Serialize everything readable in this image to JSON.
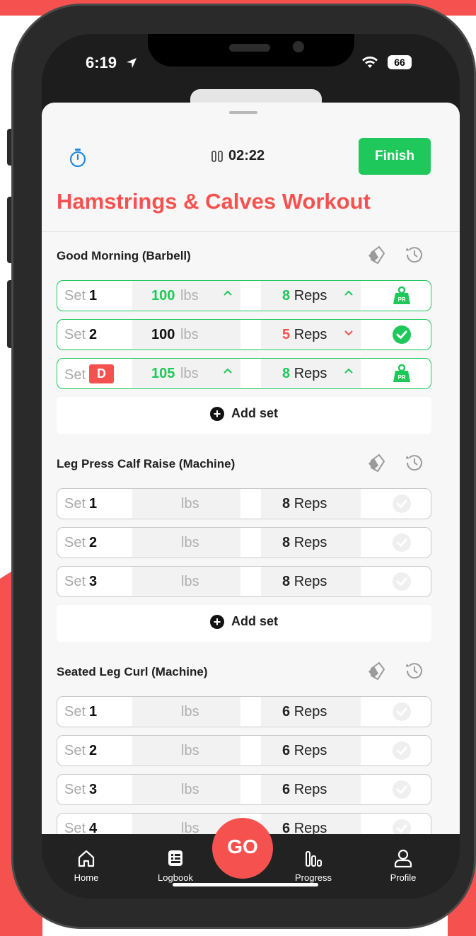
{
  "status_bar": {
    "time": "6:19",
    "battery": "66"
  },
  "header": {
    "clock": "02:22",
    "finish_label": "Finish",
    "title": "Hamstrings & Calves Workout"
  },
  "exercises": [
    {
      "name": "Good Morning (Barbell)",
      "sets": [
        {
          "label": "Set",
          "number": "1",
          "weight": "100",
          "unit": "lbs",
          "reps": "8",
          "reps_unit": "Reps",
          "weight_trend": "up",
          "reps_trend": "up",
          "status": "pr"
        },
        {
          "label": "Set",
          "number": "2",
          "weight": "100",
          "unit": "lbs",
          "reps": "5",
          "reps_unit": "Reps",
          "weight_trend": "none",
          "reps_trend": "down",
          "status": "done"
        },
        {
          "label": "Set",
          "number": "D",
          "weight": "105",
          "unit": "lbs",
          "reps": "8",
          "reps_unit": "Reps",
          "weight_trend": "up",
          "reps_trend": "up",
          "status": "pr"
        }
      ],
      "add_set_label": "Add set"
    },
    {
      "name": "Leg Press Calf Raise (Machine)",
      "sets": [
        {
          "label": "Set",
          "number": "1",
          "weight": "",
          "unit": "lbs",
          "reps": "8",
          "reps_unit": "Reps"
        },
        {
          "label": "Set",
          "number": "2",
          "weight": "",
          "unit": "lbs",
          "reps": "8",
          "reps_unit": "Reps"
        },
        {
          "label": "Set",
          "number": "3",
          "weight": "",
          "unit": "lbs",
          "reps": "8",
          "reps_unit": "Reps"
        }
      ],
      "add_set_label": "Add set"
    },
    {
      "name": "Seated Leg Curl (Machine)",
      "sets": [
        {
          "label": "Set",
          "number": "1",
          "weight": "",
          "unit": "lbs",
          "reps": "6",
          "reps_unit": "Reps"
        },
        {
          "label": "Set",
          "number": "2",
          "weight": "",
          "unit": "lbs",
          "reps": "6",
          "reps_unit": "Reps"
        },
        {
          "label": "Set",
          "number": "3",
          "weight": "",
          "unit": "lbs",
          "reps": "6",
          "reps_unit": "Reps"
        },
        {
          "label": "Set",
          "number": "4",
          "weight": "",
          "unit": "lbs",
          "reps": "6",
          "reps_unit": "Reps"
        }
      ]
    }
  ],
  "pr_badge": "PR",
  "tabs": [
    {
      "label": "Home",
      "icon": "home-icon"
    },
    {
      "label": "Logbook",
      "icon": "logbook-icon"
    },
    {
      "label": "Progress",
      "icon": "progress-icon"
    },
    {
      "label": "Profile",
      "icon": "profile-icon"
    }
  ],
  "go_label": "GO",
  "colors": {
    "accent": "#f5524f",
    "success": "#1ec85a",
    "tabbar": "#222222"
  }
}
